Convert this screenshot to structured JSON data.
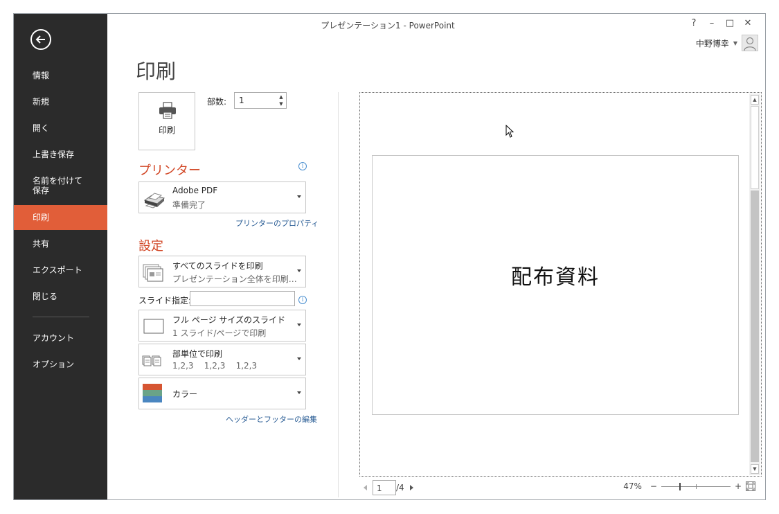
{
  "window": {
    "title": "プレゼンテーション1 - PowerPoint",
    "controls": {
      "help": "?",
      "minimize": "–",
      "maximize": "□",
      "close": "✕"
    },
    "user_name": "中野博幸"
  },
  "sidebar": {
    "items": [
      {
        "label": "情報"
      },
      {
        "label": "新規"
      },
      {
        "label": "開く"
      },
      {
        "label": "上書き保存"
      },
      {
        "label": "名前を付けて\n保存"
      },
      {
        "label": "印刷",
        "active": true
      },
      {
        "label": "共有"
      },
      {
        "label": "エクスポート"
      },
      {
        "label": "閉じる"
      },
      {
        "label": "アカウント"
      },
      {
        "label": "オプション"
      }
    ]
  },
  "page_title": "印刷",
  "print": {
    "button_label": "印刷",
    "copies_label": "部数:",
    "copies_value": "1"
  },
  "printer": {
    "heading": "プリンター",
    "name": "Adobe PDF",
    "status": "準備完了",
    "properties_link": "プリンターのプロパティ"
  },
  "settings": {
    "heading": "設定",
    "range": {
      "title": "すべてのスライドを印刷",
      "subtitle": "プレゼンテーション全体を印刷…"
    },
    "slides_label": "スライド指定:",
    "slides_value": "",
    "layout": {
      "title": "フル ページ サイズのスライド",
      "subtitle": "1 スライド/ページで印刷"
    },
    "collate": {
      "title": "部単位で印刷",
      "subtitle": "1,2,3    1,2,3    1,2,3"
    },
    "color": {
      "title": "カラー",
      "swatch_colors": [
        "#d65532",
        "#6aa388",
        "#4a86c0"
      ]
    },
    "header_footer_link": "ヘッダーとフッターの編集"
  },
  "preview": {
    "slide_text": "配布資料",
    "current_page": "1",
    "total_pages": "/4",
    "zoom": "47%"
  },
  "colors": {
    "accent": "#e15e39",
    "sidebar": "#2b2b2b",
    "heading": "#d24726",
    "link": "#2a5d95"
  }
}
